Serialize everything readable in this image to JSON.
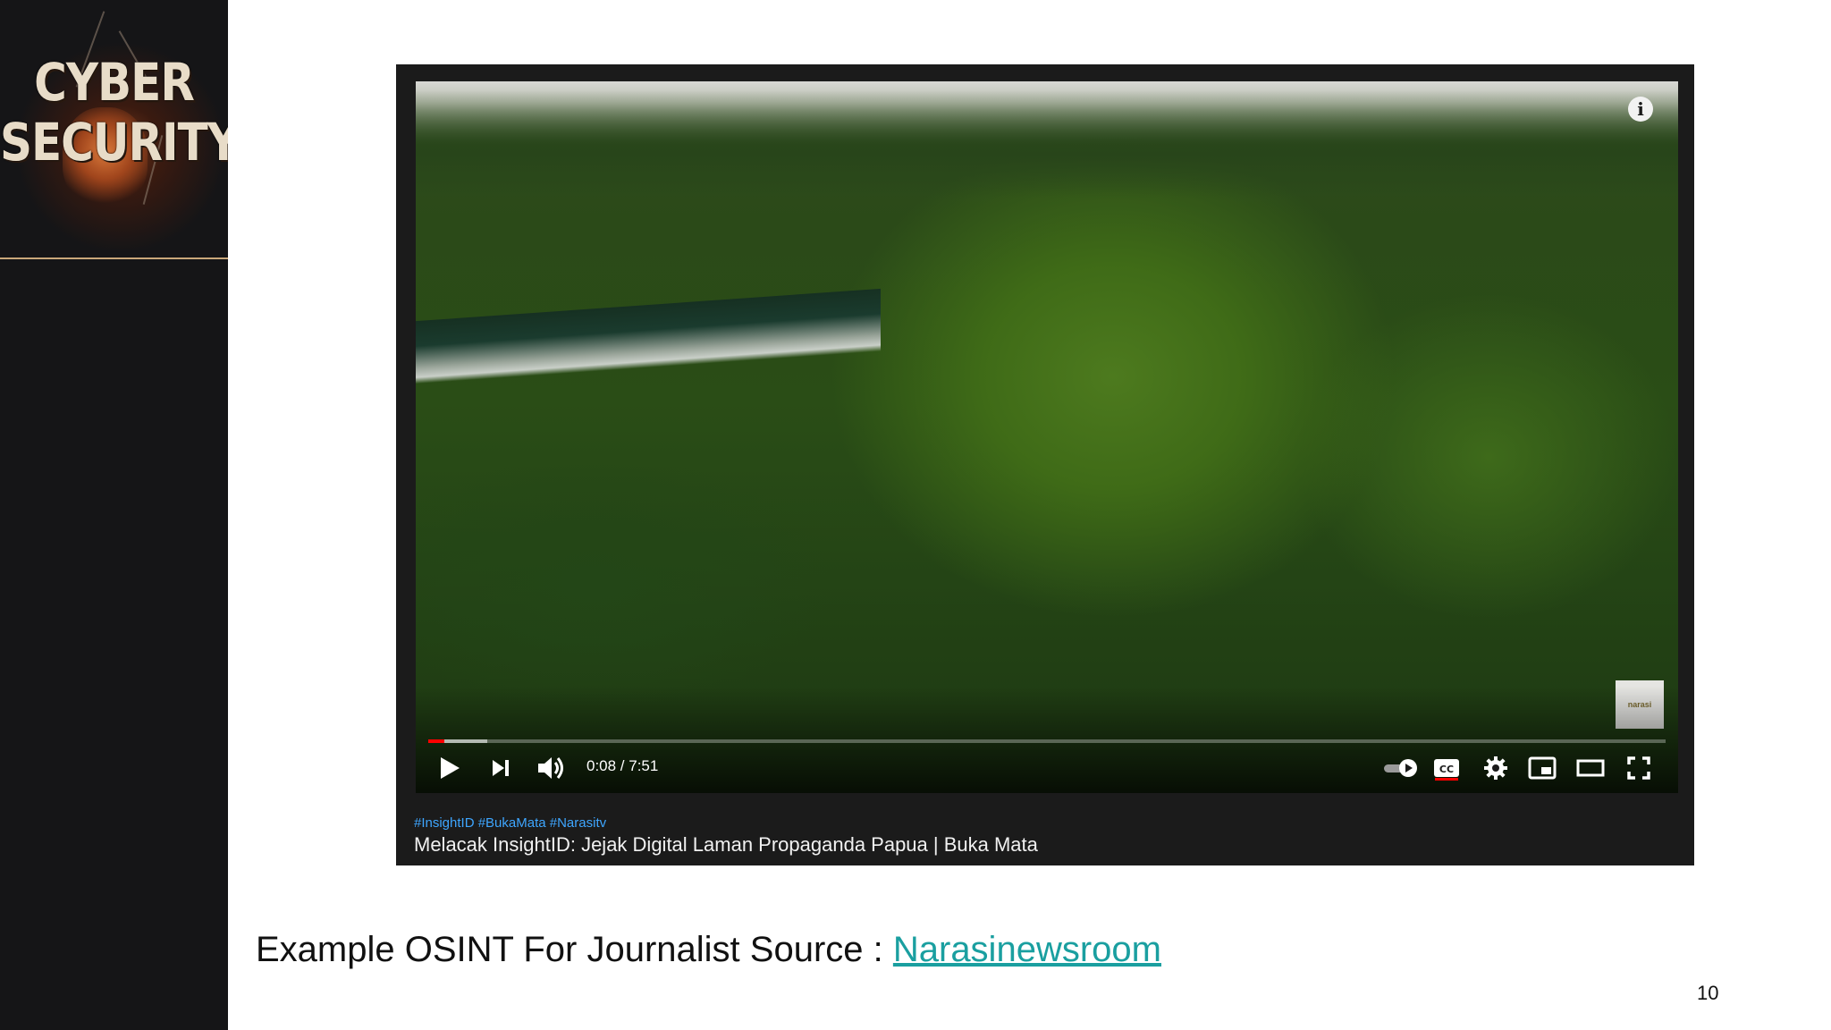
{
  "sidebar": {
    "logo_text": "CYBER SECURITY"
  },
  "video": {
    "time_display": "0:08 / 7:51",
    "progress_played_fraction": 0.013,
    "progress_buffered_fraction": 0.048,
    "badge_text": "narasi",
    "hashtags": "#InsightID #BukaMata #Narasitv",
    "title": "Melacak InsightID: Jejak Digital Laman Propaganda Papua | Buka Mata",
    "icons": [
      "play-icon",
      "next-icon",
      "volume-icon",
      "autoplay-toggle-icon",
      "cc-icon",
      "settings-gear-icon",
      "miniplayer-icon",
      "theater-icon",
      "fullscreen-icon",
      "info-icon"
    ]
  },
  "slide": {
    "caption_text": "Example OSINT For Journalist Source : ",
    "source_link": "Narasinewsroom",
    "page_number": "10"
  }
}
